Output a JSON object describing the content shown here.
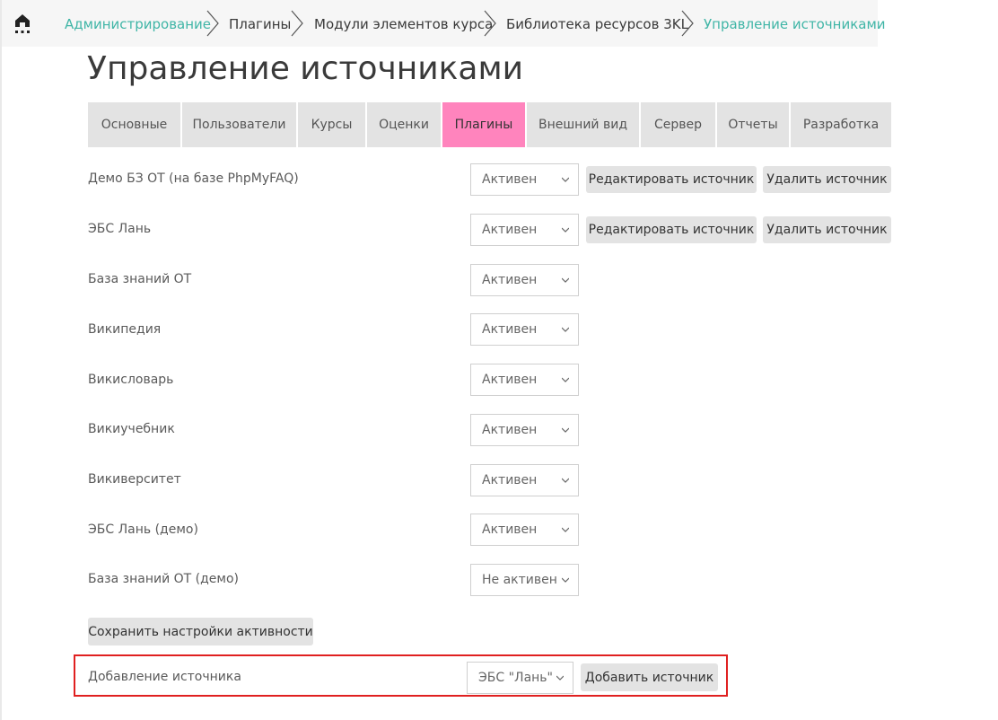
{
  "breadcrumb": {
    "home_icon": "home-icon",
    "items": [
      {
        "label": "Администрирование",
        "link": true
      },
      {
        "label": "Плагины",
        "link": false
      },
      {
        "label": "Модули элементов курса",
        "link": false
      },
      {
        "label": "Библиотека ресурсов 3KL",
        "link": false
      },
      {
        "label": "Управление источниками",
        "link": true
      }
    ]
  },
  "page": {
    "title": "Управление источниками"
  },
  "tabs": [
    {
      "label": "Основные"
    },
    {
      "label": "Пользователи"
    },
    {
      "label": "Курсы"
    },
    {
      "label": "Оценки"
    },
    {
      "label": "Плагины",
      "active": true
    },
    {
      "label": "Внешний вид"
    },
    {
      "label": "Сервер"
    },
    {
      "label": "Отчеты"
    },
    {
      "label": "Разработка"
    }
  ],
  "colors": {
    "accent_link": "#3fb5a6",
    "active_tab": "#ff84bd",
    "highlight_border": "#e02020"
  },
  "actions": {
    "edit_label": "Редактировать источник",
    "delete_label": "Удалить источник"
  },
  "sources": [
    {
      "name": "Демо БЗ ОТ (на базе PhpMyFAQ)",
      "status": "Активен",
      "editable": true
    },
    {
      "name": "ЭБС Лань",
      "status": "Активен",
      "editable": true
    },
    {
      "name": "База знаний ОТ",
      "status": "Активен",
      "editable": false
    },
    {
      "name": "Википедия",
      "status": "Активен",
      "editable": false
    },
    {
      "name": "Викисловарь",
      "status": "Активен",
      "editable": false
    },
    {
      "name": "Викиучебник",
      "status": "Активен",
      "editable": false
    },
    {
      "name": "Викиверситет",
      "status": "Активен",
      "editable": false
    },
    {
      "name": "ЭБС Лань (демо)",
      "status": "Активен",
      "editable": false
    },
    {
      "name": "База знаний ОТ (демо)",
      "status": "Не активен",
      "editable": false
    }
  ],
  "save_button": "Сохранить настройки активности",
  "add_source": {
    "label": "Добавление источника",
    "selected": "ЭБС \"Лань\"",
    "button": "Добавить источник"
  }
}
